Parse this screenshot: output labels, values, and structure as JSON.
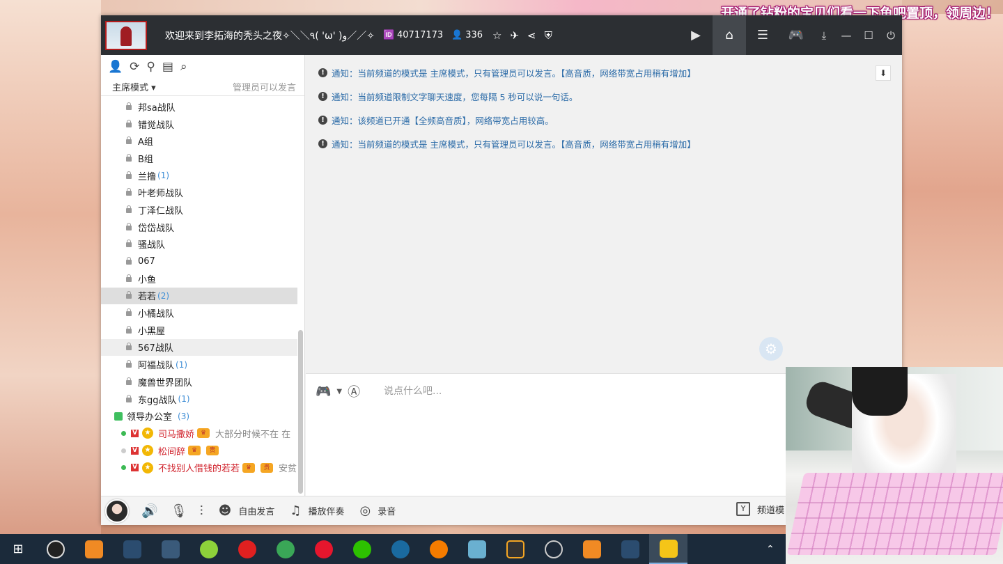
{
  "promo_text": "开通了钻粉的宝贝们看一下鱼吧置顶，领周边！",
  "window": {
    "title": "欢迎来到李拓海的秃头之夜✧＼＼٩( 'ω' )و／／✧",
    "room_id": "40717173",
    "online_count": "336",
    "id_icon": "id-card-icon",
    "user_icon": "user-icon"
  },
  "left_panel": {
    "mode_label": "主席模式",
    "mode_hint": "管理员可以发言",
    "channels": [
      {
        "name": "邦sa战队",
        "count": ""
      },
      {
        "name": "错觉战队",
        "count": ""
      },
      {
        "name": "A组",
        "count": ""
      },
      {
        "name": "B组",
        "count": ""
      },
      {
        "name": "兰撸",
        "count": "(1)"
      },
      {
        "name": "叶老师战队",
        "count": ""
      },
      {
        "name": "丁泽仁战队",
        "count": ""
      },
      {
        "name": "岱岱战队",
        "count": ""
      },
      {
        "name": "骚战队",
        "count": ""
      },
      {
        "name": "067",
        "count": ""
      },
      {
        "name": "小鱼",
        "count": ""
      },
      {
        "name": "若若",
        "count": "(2)"
      },
      {
        "name": "小橘战队",
        "count": ""
      },
      {
        "name": "小黑屋",
        "count": ""
      },
      {
        "name": "567战队",
        "count": ""
      },
      {
        "name": "阿福战队",
        "count": "(1)"
      },
      {
        "name": "魔兽世界团队",
        "count": ""
      },
      {
        "name": "东gg战队",
        "count": "(1)"
      }
    ],
    "group": {
      "name": "领导办公室",
      "count": "(3)"
    },
    "users": [
      {
        "name": "司马撒娇",
        "badge": "V",
        "sig": "大部分时候不在 在"
      },
      {
        "name": "松间辞",
        "badge": "V",
        "sig": ""
      },
      {
        "name": "不找别人借钱的若若",
        "badge": "V",
        "sig": "安贫"
      }
    ],
    "user_tags": [
      "贵",
      "贵"
    ]
  },
  "notices": [
    {
      "prefix": "通知：",
      "text": "当前频道的模式是 主席模式，只有管理员可以发言。【高音质，网络带宽占用稍有增加】"
    },
    {
      "prefix": "通知：",
      "text": "当前频道限制文字聊天速度，您每隔 5 秒可以说一句话。"
    },
    {
      "prefix": "通知：",
      "text": "该频道已开通【全频高音质】，网络带宽占用较高。"
    },
    {
      "prefix": "通知：",
      "text": "当前频道的模式是 主席模式，只有管理员可以发言。【高音质，网络带宽占用稍有增加】"
    }
  ],
  "input": {
    "placeholder": "说点什么吧..."
  },
  "bottom_bar": {
    "free_speech": "自由发言",
    "play_music": "播放伴奏",
    "record": "录音",
    "channel_mode": "频道模"
  }
}
